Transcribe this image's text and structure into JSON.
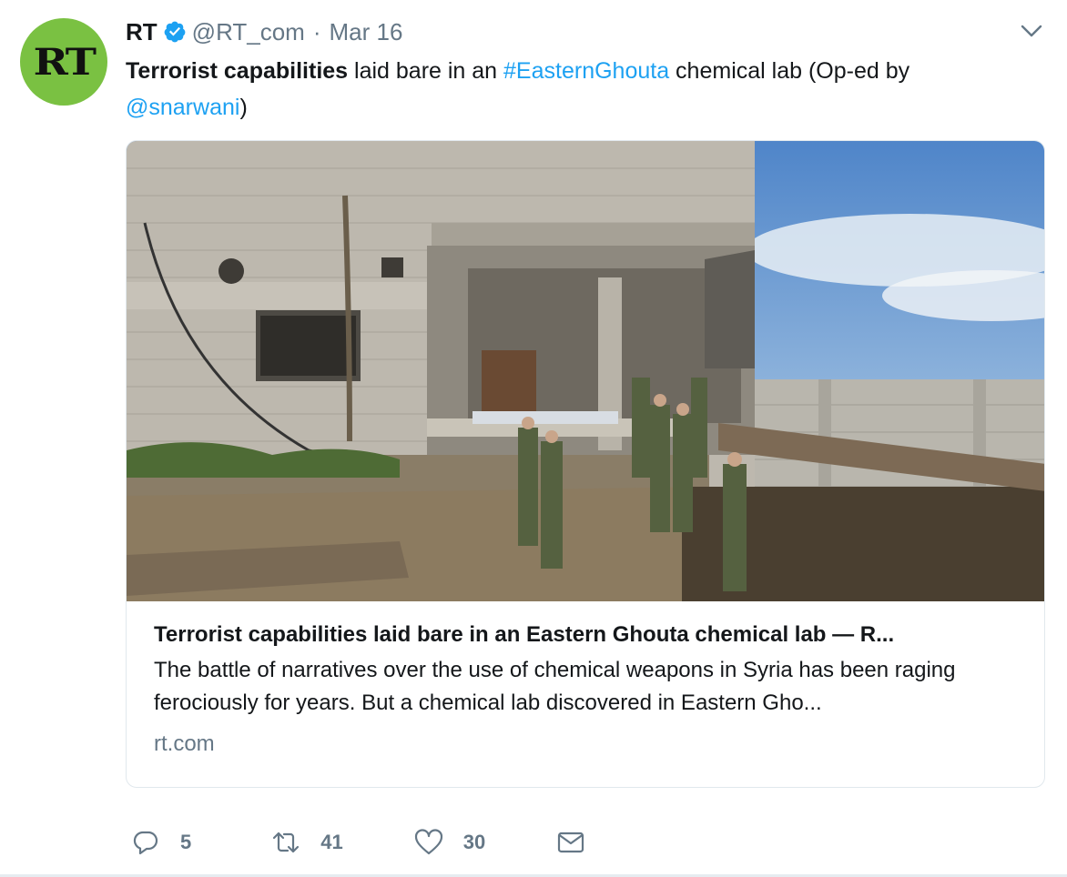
{
  "tweet": {
    "name": "RT",
    "handle": "@RT_com",
    "separator": "·",
    "date": "Mar 16",
    "avatar_text": "RT",
    "text_parts": {
      "bold": "Terrorist capabilities",
      "plain1": " laid bare in an ",
      "hashtag": "#EasternGhouta",
      "plain2": " chemical lab (Op-ed by ",
      "mention": "@snarwani",
      "plain3": ")"
    }
  },
  "card": {
    "title": "Terrorist capabilities laid bare in an Eastern Ghouta chemical lab — R...",
    "description": "The battle of narratives over the use of chemical weapons in Syria has been raging ferociously for years. But a chemical lab discovered in Eastern Gho...",
    "domain": "rt.com"
  },
  "actions": {
    "replies": "5",
    "retweets": "41",
    "likes": "30"
  },
  "icons": {
    "verified": "verified-badge-icon",
    "caret": "chevron-down-icon",
    "reply": "reply-icon",
    "retweet": "retweet-icon",
    "like": "heart-icon",
    "message": "envelope-icon"
  },
  "colors": {
    "link": "#1da1f2",
    "avatar_bg": "#7ac142",
    "secondary_text": "#657786"
  }
}
